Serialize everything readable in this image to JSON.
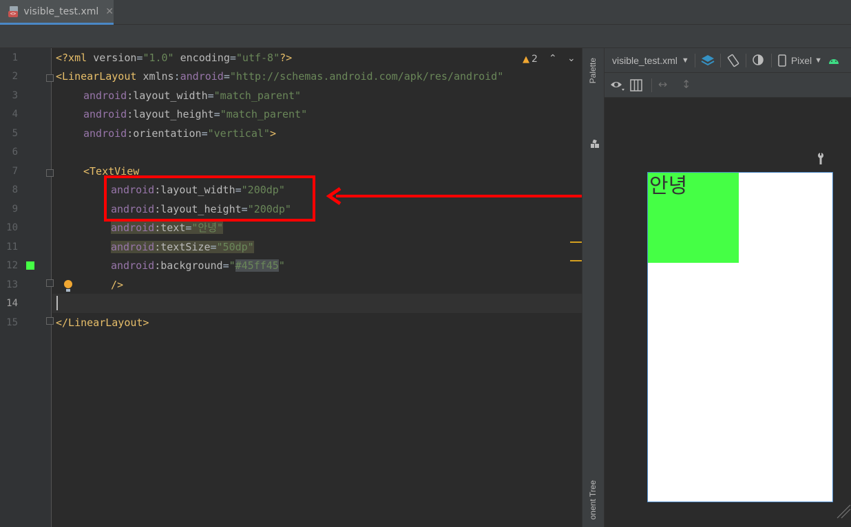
{
  "tab": {
    "title": "visible_test.xml",
    "close": "✕",
    "icon_badge": "<>"
  },
  "editor": {
    "line_numbers": [
      "1",
      "2",
      "3",
      "4",
      "5",
      "6",
      "7",
      "8",
      "9",
      "10",
      "11",
      "12",
      "13",
      "14",
      "15"
    ],
    "warnings": {
      "count": "2"
    },
    "lines": {
      "l1": {
        "a": "<?xml ",
        "b": "version",
        "c": "=",
        "d": "\"1.0\"",
        "e": " ",
        "f": "encoding",
        "g": "=",
        "h": "\"utf-8\"",
        "i": "?>"
      },
      "l2": {
        "a": "<LinearLayout ",
        "b": "xmlns",
        "c": ":",
        "d": "android",
        "e": "=",
        "f": "\"http://schemas.android.com/apk/res/android\""
      },
      "l3": {
        "ns": "android",
        "attr": ":layout_width",
        "eq": "=",
        "val": "\"match_parent\""
      },
      "l4": {
        "ns": "android",
        "attr": ":layout_height",
        "eq": "=",
        "val": "\"match_parent\""
      },
      "l5": {
        "ns": "android",
        "attr": ":orientation",
        "eq": "=",
        "val": "\"vertical\"",
        "end": ">"
      },
      "l7": {
        "tag": "<TextView"
      },
      "l8": {
        "ns": "android",
        "attr": ":layout_width",
        "eq": "=",
        "val": "\"200dp\""
      },
      "l9": {
        "ns": "android",
        "attr": ":layout_height",
        "eq": "=",
        "val": "\"200dp\""
      },
      "l10": {
        "ns": "android",
        "attr": ":text",
        "eq": "=",
        "val": "\"안녕\""
      },
      "l11": {
        "ns": "android",
        "attr": ":textSize",
        "eq": "=",
        "val": "\"50dp\""
      },
      "l12": {
        "ns": "android",
        "attr": ":background",
        "eq": "=",
        "q1": "\"",
        "val": "#45ff45",
        "q2": "\""
      },
      "l13": {
        "tag": "/>"
      },
      "l15": {
        "tag": "</LinearLayout>"
      }
    }
  },
  "side_strip": {
    "palette": "Palette",
    "component_tree": "onent Tree"
  },
  "design": {
    "file_select": "visible_test.xml",
    "device": "Pixel",
    "preview_text": "안녕",
    "preview_bg": "#45ff45",
    "icons": [
      "layers-icon",
      "rotate-icon",
      "theme-icon",
      "phone-icon",
      "android-icon",
      "eye-icon",
      "columns-icon",
      "horizontal-arrows-icon",
      "vertical-arrows-icon",
      "wrench-icon"
    ]
  },
  "annotation_color": "#ff0000"
}
